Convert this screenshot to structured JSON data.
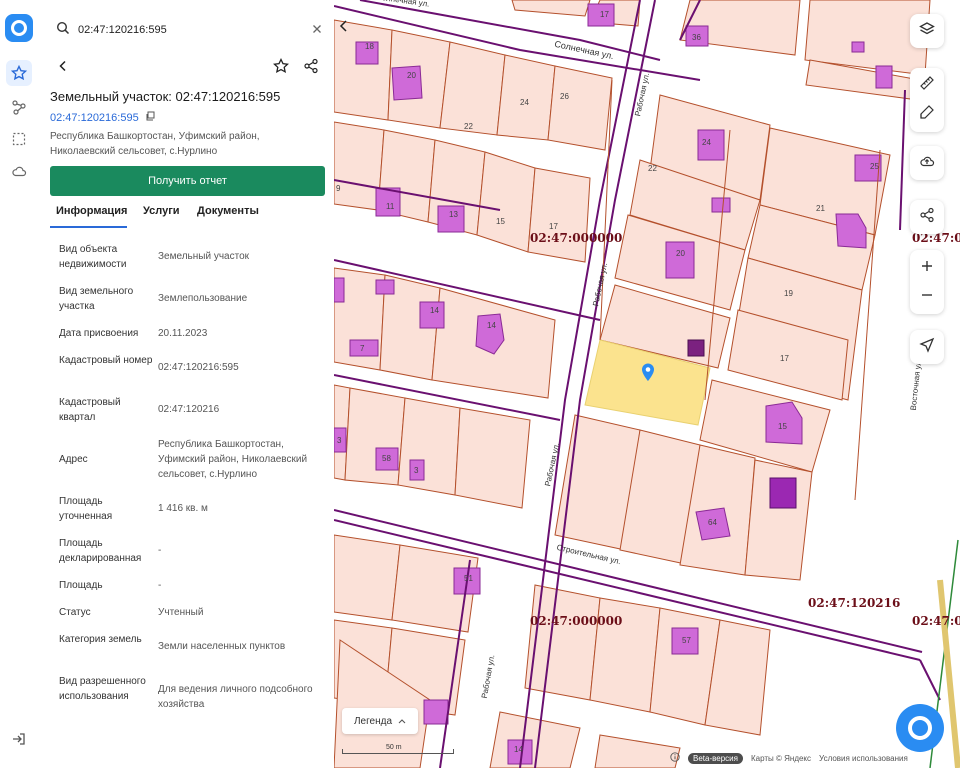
{
  "search": {
    "value": "02:47:120216:595"
  },
  "parcel": {
    "title": "Земельный участок: 02:47:120216:595",
    "cad_link": "02:47:120216:595",
    "address_line": "Республика Башкортостан, Уфимский район, Николаевский сельсовет, с.Нурлино"
  },
  "report_button": "Получить отчет",
  "tabs": [
    "Информация",
    "Услуги",
    "Документы"
  ],
  "properties": [
    {
      "key": "Вид объекта недвижимости",
      "value": "Земельный участок"
    },
    {
      "key": "Вид земельного участка",
      "value": "Землепользование"
    },
    {
      "key": "Дата присвоения",
      "value": "20.11.2023"
    },
    {
      "key": "Кадастровый номер",
      "value": "02:47:120216:595"
    },
    {
      "key": "Кадастровый квартал",
      "value": "02:47:120216"
    },
    {
      "key": "Адрес",
      "value": "Республика Башкортостан, Уфимский район, Николаевский сельсовет, с.Нурлино"
    },
    {
      "key": "Площадь уточненная",
      "value": "1 416 кв. м"
    },
    {
      "key": "Площадь декларированная",
      "value": "-"
    },
    {
      "key": "Площадь",
      "value": "-"
    },
    {
      "key": "Статус",
      "value": "Учтенный"
    },
    {
      "key": "Категория земель",
      "value": "Земли населенных пунктов"
    },
    {
      "key": "Вид разрешенного использования",
      "value": "Для ведения личного подсобного хозяйства"
    }
  ],
  "map": {
    "streets": {
      "solnechnaya": "Солнечная ул.",
      "rabochaya": "Рабочая ул.",
      "stroitelnaya": "Строительная ул.",
      "vostochnaya": "Восточная ул.",
      "solnechnaya_top": "Солнечная ул."
    },
    "quarters": [
      "02:47:000000",
      "02:47:000000",
      "02:47:120216",
      "02:47:0",
      "02:47:0"
    ],
    "lot_numbers": [
      "18",
      "20",
      "17",
      "36",
      "24",
      "26",
      "22",
      "24",
      "22",
      "25",
      "9",
      "11",
      "13",
      "15",
      "17",
      "20",
      "21",
      "19",
      "17",
      "15",
      "14",
      "14",
      "7",
      "58",
      "64",
      "51",
      "57",
      "14",
      "3",
      "3"
    ],
    "legend_label": "Легенда",
    "scale_label": "50 m",
    "beta_label": "Beta-версия",
    "attribution_maps": "Карты © Яндекс",
    "attribution_terms": "Условия использования",
    "colors": {
      "parcel_fill": "#fbe1d8",
      "parcel_line": "#b4502c",
      "building": "#cf6ad8",
      "selected": "#fbe38e",
      "quarter_line": "#6a1070",
      "quarter_text": "#6b0e18",
      "accent": "#2a8cf2",
      "report_btn": "#1a8a5e"
    }
  }
}
